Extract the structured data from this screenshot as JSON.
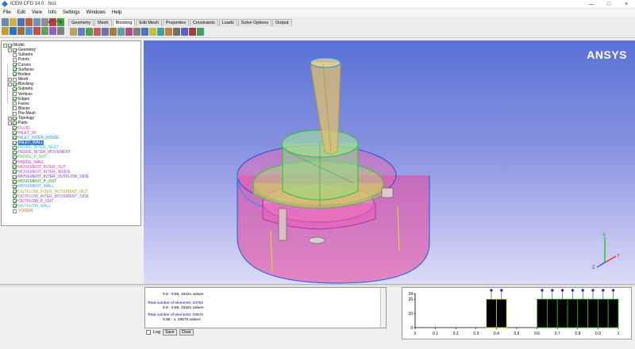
{
  "window": {
    "title": "ICEM CFD 14.0 : No1"
  },
  "window_buttons": [
    "—",
    "□",
    "×"
  ],
  "menu": [
    "File",
    "Edit",
    "View",
    "Info",
    "Settings",
    "Windows",
    "Help"
  ],
  "tabs": [
    "Geometry",
    "Mesh",
    "Blocking",
    "Edit Mesh",
    "Properties",
    "Constraints",
    "Loads",
    "Solve Options",
    "Output"
  ],
  "active_tab": "Blocking",
  "tree": {
    "root": "Model",
    "geometry": {
      "label": "Geometry",
      "children": [
        "Subsets",
        "Points",
        "Curves",
        "Surfaces",
        "Bodies"
      ]
    },
    "mesh": {
      "label": "Mesh"
    },
    "blocking": {
      "label": "Blocking",
      "children": [
        "Subsets",
        "Vertices",
        "Edges",
        "Faces",
        "Blocks",
        "Pre-Mesh"
      ]
    },
    "topology": {
      "label": "Topology"
    },
    "parts": {
      "label": "Parts",
      "items": [
        {
          "name": "FLUID",
          "color": "#e040e0"
        },
        {
          "name": "INLET_IN",
          "color": "#ff3080"
        },
        {
          "name": "INLET_INTER_INSIDE",
          "color": "#1e90ff"
        },
        {
          "name": "INLET_WALL",
          "color": "#ffffff"
        },
        {
          "name": "INSIDE_INTER_INLET",
          "color": "#22c8e8"
        },
        {
          "name": "INSIDE_INTER_MOVEMENT",
          "color": "#9a40e0"
        },
        {
          "name": "INSIDE_P_OUT",
          "color": "#40c840"
        },
        {
          "name": "INSIDE_WALL",
          "color": "#e020c0"
        },
        {
          "name": "MOVEMENT_INTER_OUT",
          "color": "#e040a0"
        },
        {
          "name": "MOVEMENT_INTER_INSIDE",
          "color": "#b050e0"
        },
        {
          "name": "MOVEMENT_INTER_OUTFLOW_SIDE",
          "color": "#8040e0"
        },
        {
          "name": "MOVEMENT_P_OUT",
          "color": "#1a9a1a"
        },
        {
          "name": "MOVEMENT_WALL",
          "color": "#30a0ff"
        },
        {
          "name": "OUTFLOW_INTER_MOVEMENT_OUT",
          "color": "#c0a020"
        },
        {
          "name": "OUTFLOW_INTER_MOVEMENT_SIDE",
          "color": "#8060e0"
        },
        {
          "name": "OUTFLOW_P_OUT",
          "color": "#e020a0"
        },
        {
          "name": "OUTFLOW_WALL",
          "color": "#40b0e0"
        },
        {
          "name": "VORDN",
          "color": "#e06020"
        }
      ]
    }
  },
  "viewport": {
    "logo_main": "ANSYS",
    "triad": {
      "x": "X",
      "y": "Y",
      "z": "Z"
    }
  },
  "messages": [
    {
      "text": "0.8 - 0.85, 15181 values",
      "color": "black"
    },
    {
      "text": "Total number of elements: 43793",
      "color": "blue"
    },
    {
      "text": "0.8 - 0.85, 15181 values",
      "color": "black"
    },
    {
      "text": "Total number of elements: 28570",
      "color": "blue"
    },
    {
      "text": "0.95 - 1, 28570 values",
      "color": "black"
    }
  ],
  "controls": {
    "log_label": "Log",
    "save_label": "Save",
    "clear_label": "Clear"
  },
  "chart_data": {
    "type": "bar",
    "x_ticks": [
      "0",
      "0.1",
      "0.2",
      "0.3",
      "0.4",
      "0.5",
      "0.6",
      "0.7",
      "0.8",
      "0.9",
      "1"
    ],
    "y_ticks": [
      "0",
      "10",
      "20",
      "24"
    ],
    "xlim": [
      0,
      1
    ],
    "ylim": [
      0,
      24
    ],
    "bars": [
      {
        "x0": 0.35,
        "x1": 0.4,
        "value": 20
      },
      {
        "x0": 0.4,
        "x1": 0.45,
        "value": 20
      },
      {
        "x0": 0.6,
        "x1": 0.65,
        "value": 20
      },
      {
        "x0": 0.65,
        "x1": 0.7,
        "value": 20
      },
      {
        "x0": 0.7,
        "x1": 0.75,
        "value": 20
      },
      {
        "x0": 0.75,
        "x1": 0.8,
        "value": 20
      },
      {
        "x0": 0.8,
        "x1": 0.85,
        "value": 20
      },
      {
        "x0": 0.85,
        "x1": 0.9,
        "value": 20
      },
      {
        "x0": 0.9,
        "x1": 0.95,
        "value": 20
      },
      {
        "x0": 0.95,
        "x1": 1.0,
        "value": 20
      }
    ],
    "bar_fill": "#000000",
    "bar_edges": [
      "#f0e020",
      "#20c020"
    ],
    "marker_color": "#2020d0",
    "grid": false
  }
}
